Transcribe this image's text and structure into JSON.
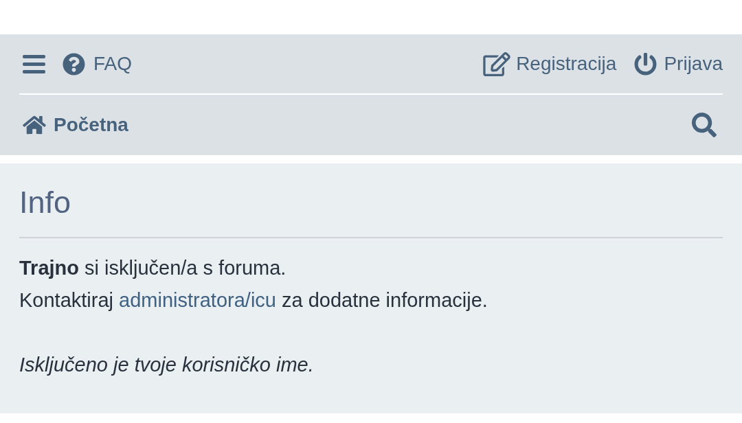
{
  "top_nav": {
    "left_links": [
      {
        "kind": "faq",
        "label": "FAQ"
      }
    ],
    "right_links": [
      {
        "kind": "register",
        "label": "Registracija"
      },
      {
        "kind": "login",
        "label": "Prijava"
      }
    ]
  },
  "breadcrumb": {
    "kind": "home",
    "label": "Početna"
  },
  "panel": {
    "title": "Info",
    "message": {
      "line_1": "**Trajno** si isključen/a s foruma.",
      "line_2": {
        "before": "Kontaktiraj",
        "link": "administratora/icu",
        "after": "za dodatne informacije."
      }
    },
    "note": "Isključeno je tvoje korisničko ime."
  }
}
